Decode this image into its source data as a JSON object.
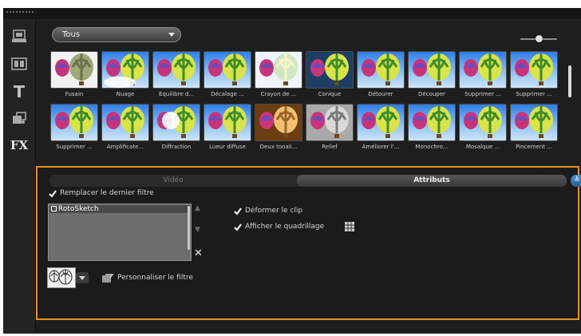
{
  "filter_select": {
    "value": "Tous"
  },
  "zoom": {
    "level": 0.5
  },
  "tiles_row1": [
    {
      "label": "Fusain",
      "style": "charcoal"
    },
    {
      "label": "Nuage",
      "style": "cloud"
    },
    {
      "label": "Équilibre d...",
      "style": "normal"
    },
    {
      "label": "Décalage ...",
      "style": "shift"
    },
    {
      "label": "Crayon de ...",
      "style": "pencil"
    },
    {
      "label": "Conique",
      "style": "dark"
    },
    {
      "label": "Détourer",
      "style": "normal"
    },
    {
      "label": "Découper",
      "style": "normal"
    },
    {
      "label": "Supprimer ...",
      "style": "normal"
    },
    {
      "label": "Supprimer ...",
      "style": "normal"
    }
  ],
  "tiles_row2": [
    {
      "label": "Supprimer ...",
      "style": "normal"
    },
    {
      "label": "Amplificate...",
      "style": "normal"
    },
    {
      "label": "Diffraction",
      "style": "diffraction"
    },
    {
      "label": "Lueur diffuse",
      "style": "normal"
    },
    {
      "label": "Deux tonali...",
      "style": "twotone"
    },
    {
      "label": "Relief",
      "style": "relief"
    },
    {
      "label": "Améliorer l'...",
      "style": "normal"
    },
    {
      "label": "Monochro...",
      "style": "normal"
    },
    {
      "label": "Mosaïque ...",
      "style": "normal"
    },
    {
      "label": "Pincement ...",
      "style": "normal"
    }
  ],
  "tabs": {
    "video": "Vidéo",
    "attributes": "Attributs"
  },
  "options": {
    "replace_last_filter": "Remplacer le dernier filtre",
    "deform_clip": "Déformer le clip",
    "show_grid": "Afficher le quadrillage"
  },
  "filter_list": [
    "RotoSketch"
  ],
  "customize_label": "Personnaliser le filtre",
  "colors": {
    "accent": "#e8901c",
    "panel": "#1b1b1b",
    "toolbar": "#232323"
  }
}
